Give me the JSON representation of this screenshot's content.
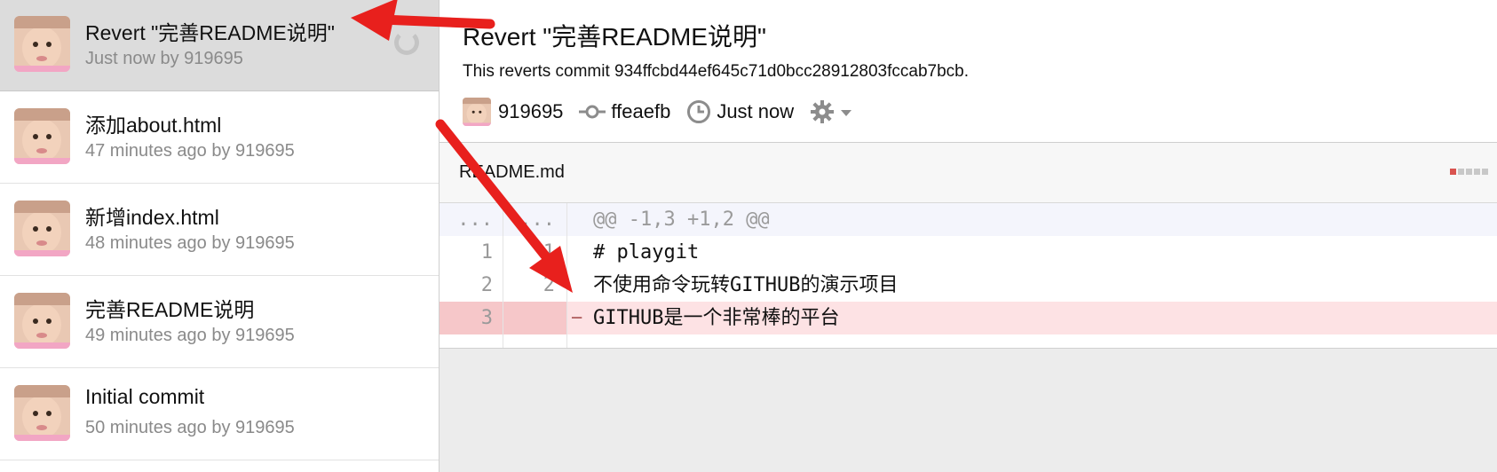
{
  "commits": [
    {
      "title": "Revert \"完善README说明\"",
      "subtitle": "Just now by 919695",
      "selected": true
    },
    {
      "title": "添加about.html",
      "subtitle": "47 minutes ago by 919695"
    },
    {
      "title": "新增index.html",
      "subtitle": "48 minutes ago by 919695"
    },
    {
      "title": "完善README说明",
      "subtitle": "49 minutes ago by 919695"
    },
    {
      "title": "Initial commit",
      "subtitle": "50 minutes ago by 919695"
    }
  ],
  "detail": {
    "title": "Revert \"完善README说明\"",
    "description": "This reverts commit 934ffcbd44ef645c71d0bcc28912803fccab7bcb.",
    "author": "919695",
    "sha": "ffeaefb",
    "time": "Just now"
  },
  "file": {
    "name": "README.md",
    "hunk_old": "...",
    "hunk_new": "...",
    "hunk_header": "@@ -1,3 +1,2 @@",
    "lines": [
      {
        "old": "1",
        "new": "1",
        "sign": "",
        "text": "# playgit"
      },
      {
        "old": "2",
        "new": "2",
        "sign": "",
        "text": "不使用命令玩转GITHUB的演示项目"
      },
      {
        "old": "3",
        "new": "",
        "sign": "−",
        "text": "GITHUB是一个非常棒的平台"
      }
    ]
  },
  "colors": {
    "deleted_bg": "#fde2e4",
    "deleted_gutter": "#f6c7c9",
    "annotation_arrow": "#e8201d"
  }
}
